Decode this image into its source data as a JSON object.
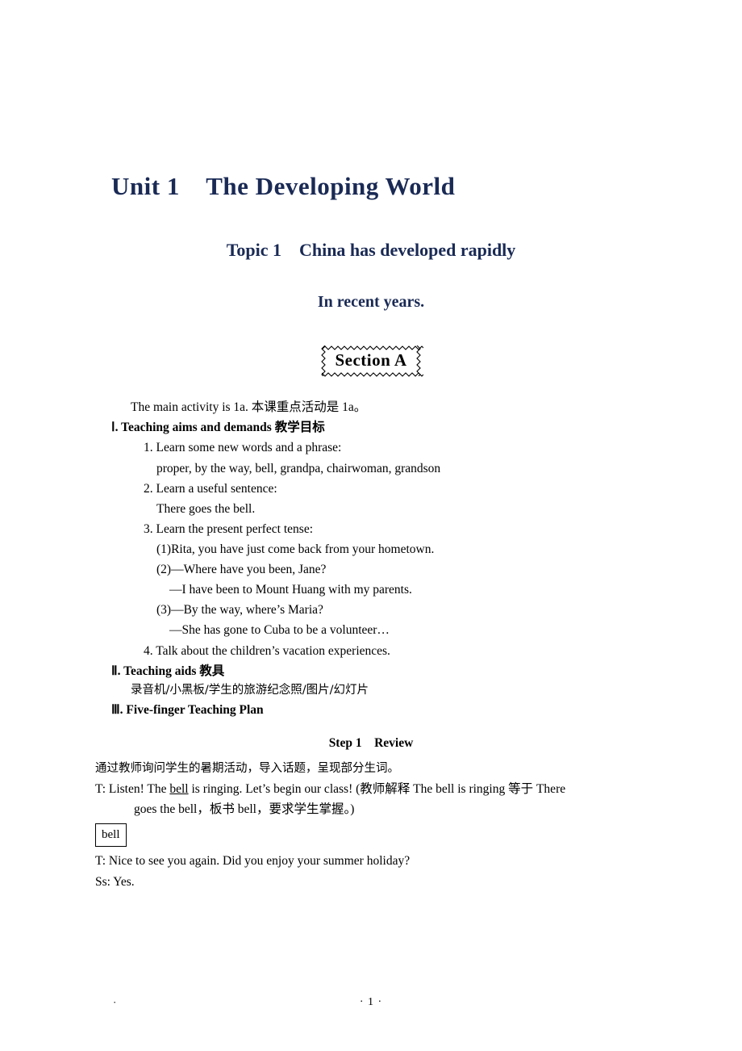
{
  "document": {
    "unit_title": "Unit 1    The Developing World",
    "topic_title": "Topic 1    China has developed rapidly",
    "topic_title_line2": "In recent years.",
    "section_label": "Section A",
    "intro": "The main activity is 1a.  本课重点活动是 1a。",
    "sections": [
      {
        "heading": "Ⅰ. Teaching aims and demands  教学目标",
        "items": [
          "1. Learn some new words and a phrase:",
          "proper, by the way, bell, grandpa, chairwoman, grandson",
          "2. Learn a useful sentence:",
          "There goes the bell.",
          "3. Learn the present perfect tense:",
          "(1)Rita, you have just come back from your hometown.",
          "(2)—Where have you been, Jane?",
          "—I have been to Mount Huang with my parents.",
          "(3)—By the way, where’s Maria?",
          "—She has gone to Cuba to be a volunteer…",
          "4. Talk about the children’s vacation experiences."
        ]
      },
      {
        "heading": "Ⅱ. Teaching aids  教具",
        "items": [
          "录音机/小黑板/学生的旅游纪念照/图片/幻灯片"
        ]
      },
      {
        "heading": "Ⅲ. Five-finger Teaching Plan",
        "items": []
      }
    ],
    "step_title": "Step 1    Review",
    "step_body": {
      "line1": "通过教师询问学生的暑期活动，导入话题，呈现部分生词。",
      "line2_a": "T: Listen! The ",
      "line2_b": "bell",
      "line2_c": " is ringing. Let’s begin our class! (教师解释 The bell is ringing 等于 There",
      "line3": "goes the bell，板书 bell，要求学生掌握。)",
      "boxword": "bell",
      "line4": "T:  Nice to see you again. Did you enjoy your summer holiday?",
      "line5": "Ss: Yes."
    },
    "footer": {
      "mark": "·",
      "page": "· 1 ·"
    }
  }
}
